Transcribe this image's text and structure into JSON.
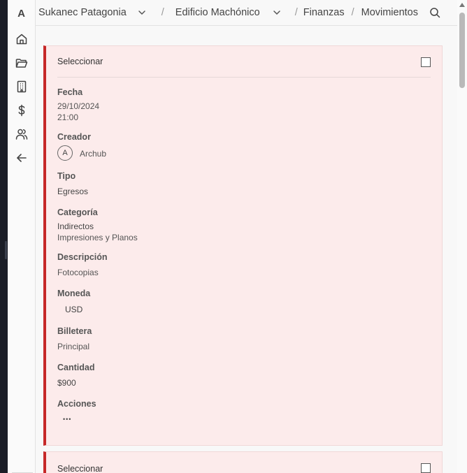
{
  "app": {
    "logo_letter": "A"
  },
  "sidebar": {
    "items": [
      {
        "name": "home-icon"
      },
      {
        "name": "folder-icon"
      },
      {
        "name": "building-icon"
      },
      {
        "name": "dollar-icon"
      },
      {
        "name": "users-icon"
      },
      {
        "name": "arrow-left-icon"
      }
    ]
  },
  "breadcrumb": {
    "org": "Sukanec Patagonia",
    "project": "Edificio Machónico",
    "section": "Finanzas",
    "page": "Movimientos"
  },
  "cards": [
    {
      "select_label": "Seleccionar",
      "fecha_label": "Fecha",
      "fecha_date": "29/10/2024",
      "fecha_time": "21:00",
      "creador_label": "Creador",
      "creador_initial": "A",
      "creador_name": "Archub",
      "tipo_label": "Tipo",
      "tipo_value": "Egresos",
      "categoria_label": "Categoría",
      "categoria_main": "Indirectos",
      "categoria_sub": "Impresiones y Planos",
      "descripcion_label": "Descripción",
      "descripcion_value": "Fotocopias",
      "moneda_label": "Moneda",
      "moneda_value": "USD",
      "billetera_label": "Billetera",
      "billetera_value": "Principal",
      "cantidad_label": "Cantidad",
      "cantidad_value": "$900",
      "acciones_label": "Acciones",
      "acciones_value": "•••"
    },
    {
      "select_label": "Seleccionar"
    }
  ],
  "colors": {
    "accent": "#c62828",
    "card_bg": "#fcebeb"
  }
}
